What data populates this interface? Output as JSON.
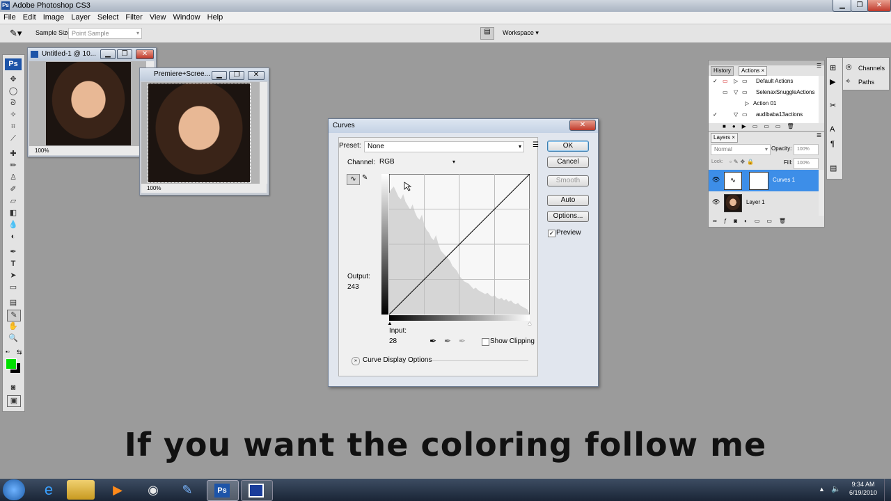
{
  "app": {
    "title": "Adobe Photoshop CS3",
    "logo": "Ps"
  },
  "menu": [
    "File",
    "Edit",
    "Image",
    "Layer",
    "Select",
    "Filter",
    "View",
    "Window",
    "Help"
  ],
  "options": {
    "sample_size_label": "Sample Size:",
    "sample_size_value": "Point Sample",
    "workspace_label": "Workspace"
  },
  "docs": [
    {
      "title": "Untitled-1 @ 10...",
      "zoom": "100%"
    },
    {
      "title": "Premiere+Scree...",
      "zoom": "100%"
    }
  ],
  "curves": {
    "title": "Curves",
    "preset_label": "Preset:",
    "preset_value": "None",
    "channel_label": "Channel:",
    "channel_value": "RGB",
    "output_label": "Output:",
    "output_value": "243",
    "input_label": "Input:",
    "input_value": "28",
    "show_clipping_label": "Show Clipping",
    "curve_display_options_label": "Curve Display Options",
    "buttons": {
      "ok": "OK",
      "cancel": "Cancel",
      "smooth": "Smooth",
      "auto": "Auto",
      "options": "Options..."
    },
    "preview_label": "Preview",
    "preview_checked": true,
    "histogram": [
      95,
      98,
      100,
      96,
      92,
      90,
      94,
      88,
      85,
      82,
      86,
      80,
      76,
      74,
      78,
      70,
      66,
      64,
      60,
      58,
      62,
      55,
      50,
      48,
      46,
      44,
      42,
      38,
      36,
      34,
      30,
      28,
      26,
      25,
      24,
      22,
      20,
      21,
      19,
      18,
      17,
      16,
      17,
      15,
      14,
      15,
      13,
      12,
      13,
      11,
      12,
      10,
      11,
      9,
      8,
      9,
      7,
      6,
      5,
      4
    ]
  },
  "history_panel": {
    "tabs": [
      "History",
      "Actions"
    ],
    "actions": [
      {
        "label": "Default Actions",
        "checked": true
      },
      {
        "label": "SelenaxSnuggleActions",
        "checked": false
      },
      {
        "label": "Action 01",
        "checked": false
      },
      {
        "label": "audibaba13actions",
        "checked": true
      }
    ]
  },
  "side_panel": {
    "channels": "Channels",
    "paths": "Paths"
  },
  "layers_panel": {
    "tab": "Layers",
    "blend_mode": "Normal",
    "opacity_label": "Opacity:",
    "opacity_value": "100%",
    "lock_label": "Lock:",
    "fill_label": "Fill:",
    "fill_value": "100%",
    "layers": [
      "Curves 1",
      "Layer 1"
    ]
  },
  "taskbar": {
    "time": "9:34 AM",
    "date": "6/19/2010",
    "ps_label": "Ps"
  },
  "caption": "If you want the coloring follow me",
  "colors": {
    "foreground": "#00e000",
    "background": "#000000",
    "accent": "#3d8ee8"
  }
}
